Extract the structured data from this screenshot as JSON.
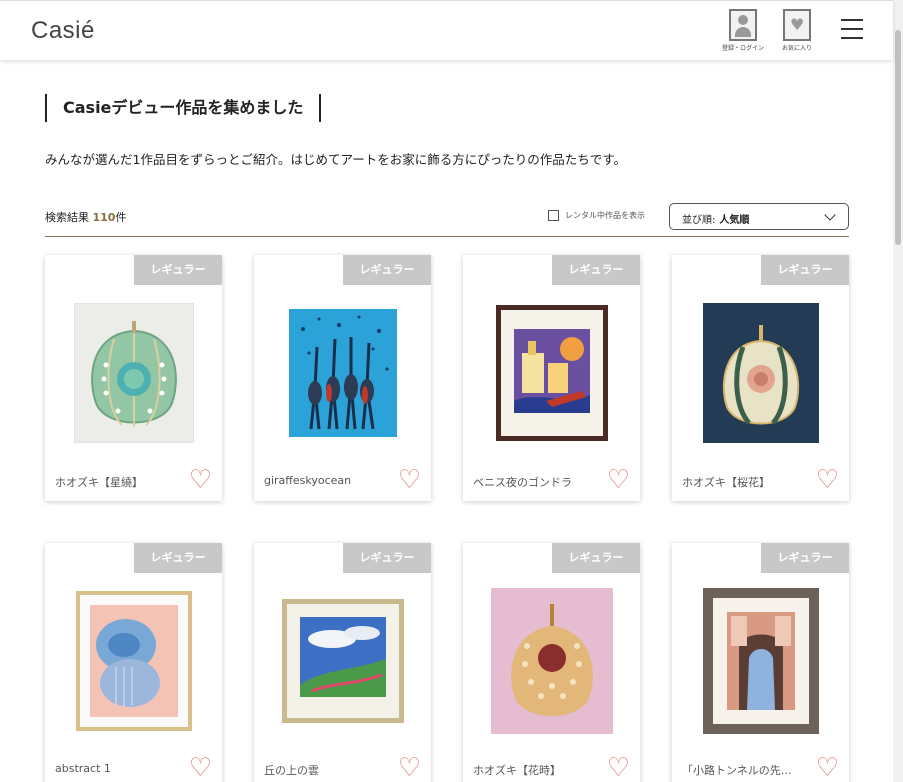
{
  "header": {
    "logo": "Casié",
    "login_label": "登録・ログイン",
    "favorites_label": "お気に入り"
  },
  "page": {
    "title": "Casieデビュー作品を集めました",
    "lead": "みんなが選んだ1作品目をずらっとご紹介。はじめてアートをお家に飾る方にぴったりの作品たちです。"
  },
  "toolbar": {
    "result_label": "検索結果",
    "result_count": "110",
    "result_unit": "件",
    "rental_label": "レンタル中作品を表示",
    "sort_label": "並び順:",
    "sort_value": "人気順"
  },
  "items": [
    {
      "badge": "レギュラー",
      "name": "ホオズキ【星繞】"
    },
    {
      "badge": "レギュラー",
      "name": "giraffeskyocean"
    },
    {
      "badge": "レギュラー",
      "name": "ベニス夜のゴンドラ"
    },
    {
      "badge": "レギュラー",
      "name": "ホオズキ【桜花】"
    },
    {
      "badge": "レギュラー",
      "name": "abstract 1"
    },
    {
      "badge": "レギュラー",
      "name": "丘の上の雲"
    },
    {
      "badge": "レギュラー",
      "name": "ホオズキ【花時】"
    },
    {
      "badge": "レギュラー",
      "name": "「小路トンネルの先…"
    }
  ],
  "colors": {
    "heart": "#e07c7c",
    "badge": "#c8c8c8",
    "accent": "#8a6d3b"
  }
}
